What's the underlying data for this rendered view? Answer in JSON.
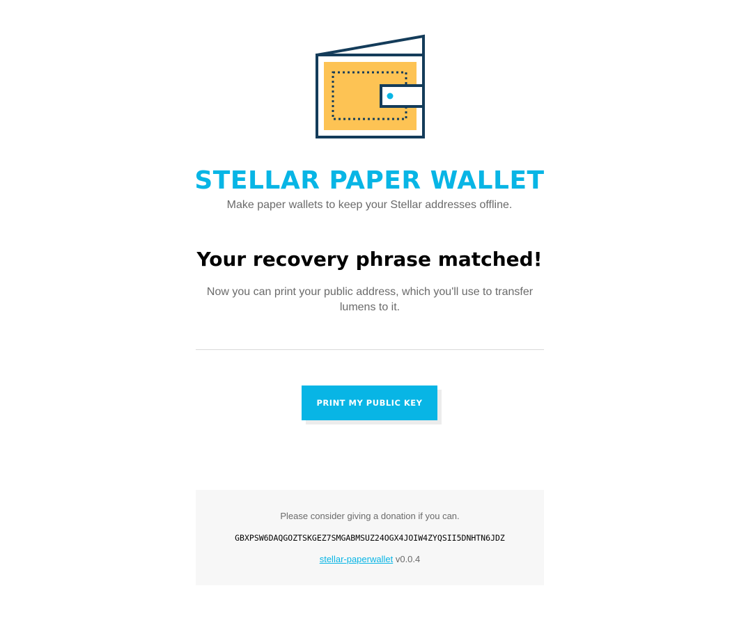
{
  "header": {
    "logo_icon": "wallet-icon",
    "title": "STELLAR PAPER WALLET",
    "subtitle": "Make paper wallets to keep your Stellar addresses offline."
  },
  "main": {
    "heading": "Your recovery phrase matched!",
    "description": "Now you can print your public address, which you'll use to transfer lumens to it.",
    "print_button_label": "PRINT MY PUBLIC KEY"
  },
  "footer": {
    "donation_text": "Please consider giving a donation if you can.",
    "donation_address": "GBXPSW6DAQGOZTSKGEZ7SMGABMSUZ24OGX4JOIW4ZYQSII5DNHTN6JDZ",
    "repo_link_label": "stellar-paperwallet",
    "version": "v0.0.4"
  },
  "colors": {
    "accent": "#08b5e5",
    "wallet_fill": "#fdc354",
    "wallet_stroke": "#143c5a"
  }
}
